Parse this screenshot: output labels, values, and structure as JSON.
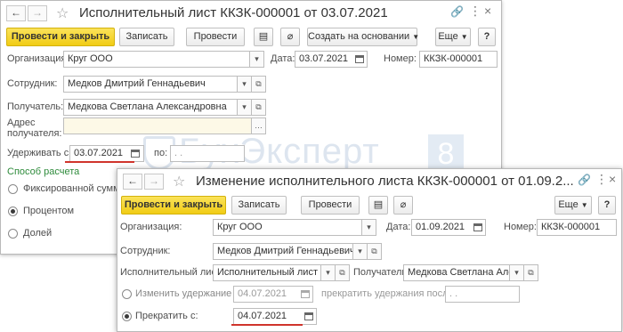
{
  "colors": {
    "primary_button": "#f1cc15",
    "underline_accent": "#d0342c",
    "radio_group_title": "#2e8b3b"
  },
  "doc1": {
    "title": "Исполнительный лист ККЗК-000001 от 03.07.2021",
    "toolbar": {
      "post_close": "Провести и закрыть",
      "save": "Записать",
      "post": "Провести",
      "create_based": "Создать на основании",
      "more": "Еще",
      "help": "?"
    },
    "fields": {
      "org_label": "Организация:",
      "org_value": "Круг ООО",
      "date_label": "Дата:",
      "date_value": "03.07.2021",
      "number_label": "Номер:",
      "number_value": "ККЗК-000001",
      "employee_label": "Сотрудник:",
      "employee_value": "Медков Дмитрий Геннадьевич",
      "recipient_label": "Получатель:",
      "recipient_value": "Медкова Светлана Александровна",
      "address_label_1": "Адрес",
      "address_label_2": "получателя:",
      "address_value": "",
      "withhold_from_label": "Удерживать с:",
      "withhold_from_value": "03.07.2021",
      "withhold_to_label": "по:",
      "withhold_to_value": ". .",
      "calc_method_title": "Способ расчета",
      "calc_options": [
        "Фиксированной суммой",
        "Процентом",
        "Долей"
      ],
      "calc_selected": "Процентом"
    }
  },
  "doc2": {
    "title": "Изменение исполнительного листа ККЗК-000001 от 01.09.2...",
    "toolbar": {
      "post_close": "Провести и закрыть",
      "save": "Записать",
      "post": "Провести",
      "more": "Еще",
      "help": "?"
    },
    "fields": {
      "org_label": "Организация:",
      "org_value": "Круг ООО",
      "date_label": "Дата:",
      "date_value": "01.09.2021",
      "number_label": "Номер:",
      "number_value": "ККЗК-000001",
      "employee_label": "Сотрудник:",
      "employee_value": "Медков Дмитрий Геннадьевич",
      "writ_label": "Исполнительный лист:",
      "writ_value": "Исполнительный лист ККЗ",
      "recipient_label": "Получатель:",
      "recipient_value": "Медкова Светлана Алекс",
      "change_label": "Изменить удержание с:",
      "change_value": "04.07.2021",
      "stop_after_label": "прекратить удержания после:",
      "stop_after_value": ". .",
      "terminate_label": "Прекратить с:",
      "terminate_value": "04.07.2021",
      "selected_option": "Прекратить с:"
    }
  },
  "watermark": {
    "text": "БухЭксперт",
    "digit": "8"
  }
}
